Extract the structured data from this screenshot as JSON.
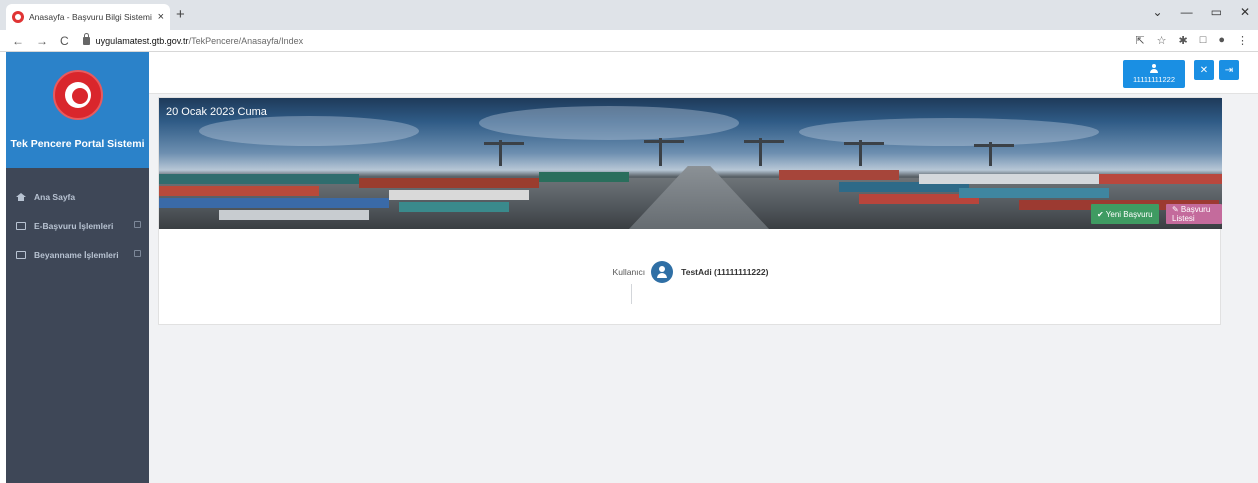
{
  "browser": {
    "tab_title": "Anasayfa - Başvuru Bilgi Sistemi",
    "tab_close": "×",
    "new_tab": "+",
    "url_host": "uygulamatest.gtb.gov.tr",
    "url_path": "/TekPencere/Anasayfa/Index",
    "window_controls": [
      "⌄",
      "—",
      "▭",
      "✕"
    ]
  },
  "sidebar": {
    "title": "Tek Pencere Portal Sistemi",
    "items": [
      {
        "label": "Ana Sayfa",
        "icon": "home-icon"
      },
      {
        "label": "E-Başvuru İşlemleri",
        "icon": "image-icon"
      },
      {
        "label": "Beyanname İşlemleri",
        "icon": "image-icon"
      }
    ]
  },
  "header": {
    "user_id": "11111111222",
    "expand_icon": "✕",
    "logout_icon": "⇥"
  },
  "banner": {
    "date": "20 Ocak 2023 Cuma",
    "new_button": "✔ Yeni Başvuru",
    "list_button": "✎ Başvuru Listesi"
  },
  "user": {
    "label": "Kullanıcı",
    "name": "TestAdi (11111111222)"
  },
  "colors": {
    "sidebar": "#3e4757",
    "logo_area": "#2b82c9",
    "primary_button": "#1a8fe3",
    "new_button": "#3f9b62",
    "list_button": "#c46b9c"
  }
}
